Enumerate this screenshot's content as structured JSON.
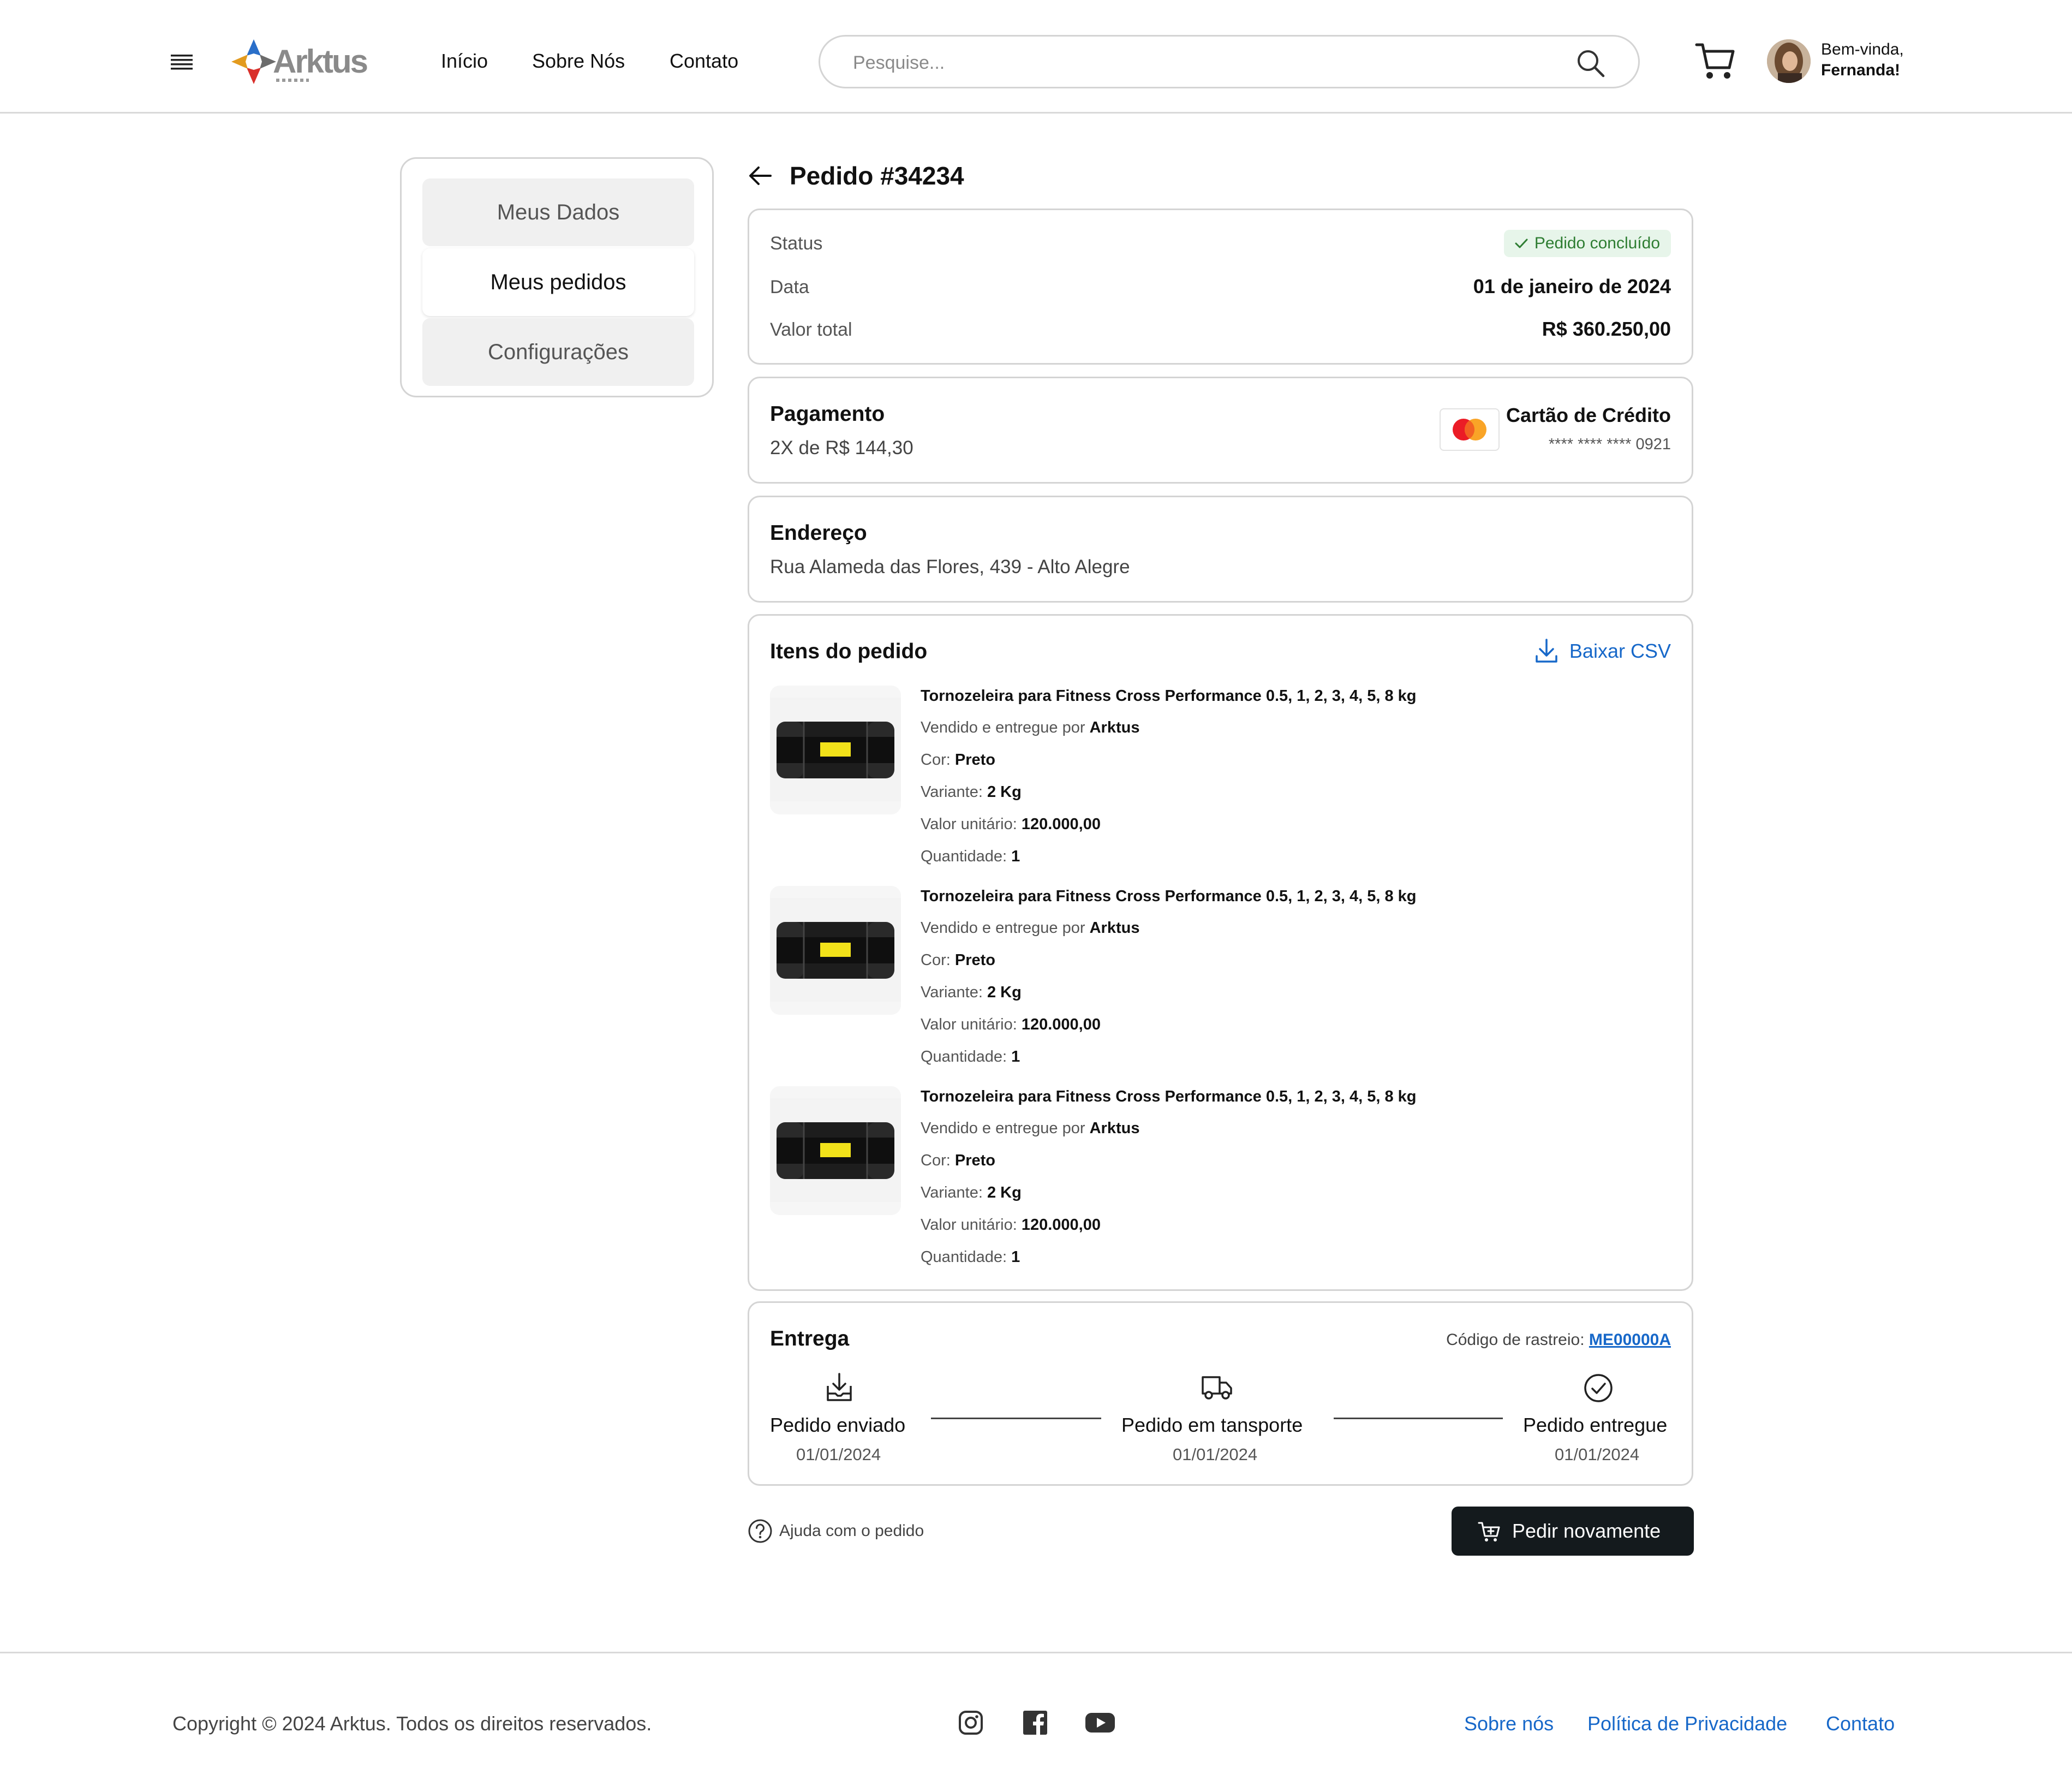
{
  "header": {
    "brand": "Arktus",
    "nav": [
      "Início",
      "Sobre Nós",
      "Contato"
    ],
    "search_placeholder": "Pesquise...",
    "greeting_line1": "Bem-vinda,",
    "greeting_line2": "Fernanda!"
  },
  "sidebar": {
    "items": [
      {
        "label": "Meus Dados",
        "active": false
      },
      {
        "label": "Meus pedidos",
        "active": true
      },
      {
        "label": "Configurações",
        "active": false
      }
    ]
  },
  "order": {
    "title": "Pedido #34234",
    "status_label": "Status",
    "status_value": "Pedido concluído",
    "date_label": "Data",
    "date_value": "01 de janeiro de 2024",
    "total_label": "Valor total",
    "total_value": "R$ 360.250,00"
  },
  "payment": {
    "title": "Pagamento",
    "installments": "2X de R$ 144,30",
    "method": "Cartão de Crédito",
    "card_number": "**** **** **** 0921"
  },
  "address": {
    "title": "Endereço",
    "value": "Rua Alameda das Flores, 439 - Alto Alegre"
  },
  "items_section": {
    "title": "Itens do pedido",
    "download_label": "Baixar CSV",
    "labels": {
      "sold_by": "Vendido e entregue por",
      "color": "Cor:",
      "variant": "Variante:",
      "unit_price": "Valor unitário:",
      "quantity": "Quantidade:"
    },
    "items": [
      {
        "name": "Tornozeleira para Fitness Cross Performance 0.5, 1, 2, 3, 4, 5, 8 kg",
        "seller": "Arktus",
        "color": "Preto",
        "variant": "2 Kg",
        "unit_price": "120.000,00",
        "quantity": "1"
      },
      {
        "name": "Tornozeleira para Fitness Cross Performance 0.5, 1, 2, 3, 4, 5, 8 kg",
        "seller": "Arktus",
        "color": "Preto",
        "variant": "2 Kg",
        "unit_price": "120.000,00",
        "quantity": "1"
      },
      {
        "name": "Tornozeleira para Fitness Cross Performance 0.5, 1, 2, 3, 4, 5, 8 kg",
        "seller": "Arktus",
        "color": "Preto",
        "variant": "2 Kg",
        "unit_price": "120.000,00",
        "quantity": "1"
      }
    ]
  },
  "delivery": {
    "title": "Entrega",
    "tracking_label": "Código de rastreio:",
    "tracking_code": "ME00000A",
    "steps": [
      {
        "label": "Pedido enviado",
        "date": "01/01/2024"
      },
      {
        "label": "Pedido em tansporte",
        "date": "01/01/2024"
      },
      {
        "label": "Pedido entregue",
        "date": "01/01/2024"
      }
    ]
  },
  "actions": {
    "help": "Ajuda com o pedido",
    "reorder": "Pedir novamente"
  },
  "footer": {
    "copyright": "Copyright © 2024 Arktus. Todos os direitos reservados.",
    "links": [
      "Sobre nós",
      "Política de Privacidade",
      "Contato"
    ]
  },
  "colors": {
    "accent_blue": "#1768c9",
    "success_bg": "#e7f5ea",
    "success_text": "#2e7d32",
    "dark_button": "#141a1d"
  }
}
